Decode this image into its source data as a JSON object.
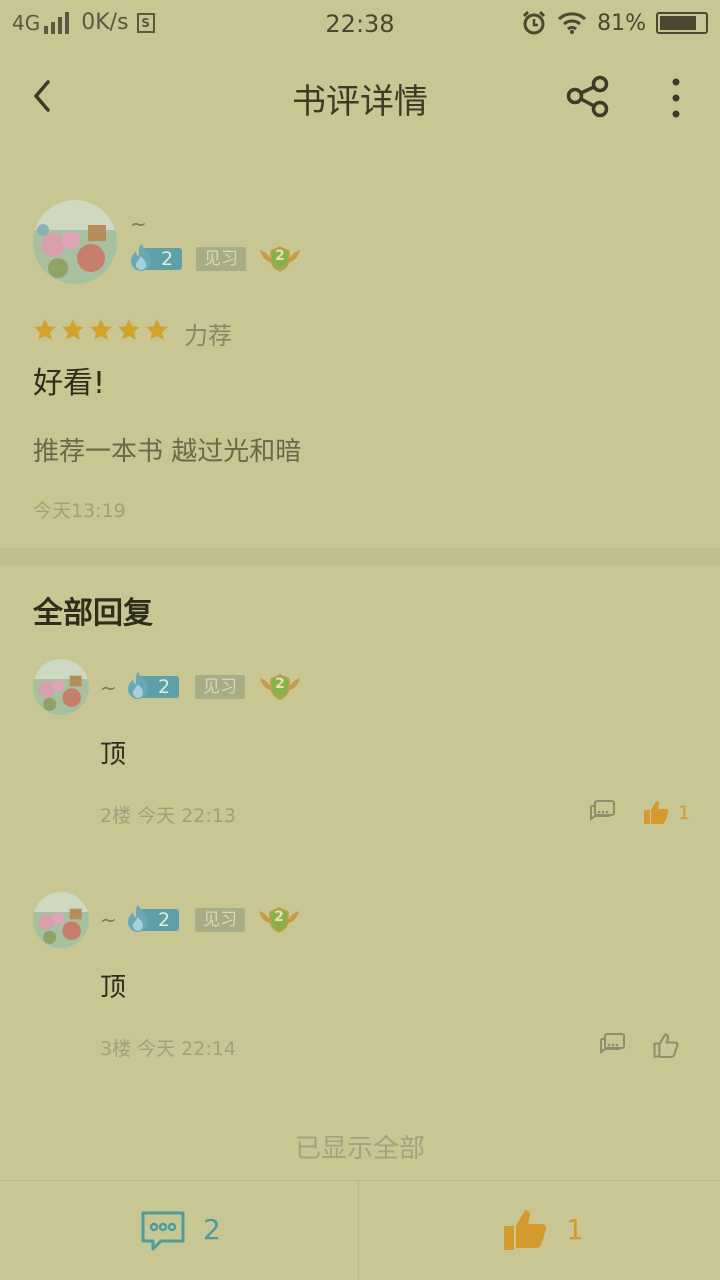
{
  "status_bar": {
    "network": "4G",
    "speed": "0K/s",
    "sim_icon": "S",
    "time": "22:38",
    "battery": "81%",
    "battery_level": 0.81
  },
  "header": {
    "title": "书评详情"
  },
  "review": {
    "nickname": "~",
    "fire_level": "2",
    "level_tag": "见习",
    "medal_level": "2",
    "stars": 5,
    "rating_label": "力荐",
    "title": "好看!",
    "body": "推荐一本书 越过光和暗",
    "time": "今天13:19"
  },
  "replies_section": {
    "title": "全部回复",
    "replies": [
      {
        "nickname": "~",
        "fire_level": "2",
        "level_tag": "见习",
        "medal_level": "2",
        "text": "顶",
        "meta": "2楼 今天 22:13",
        "likes": "1",
        "liked": true
      },
      {
        "nickname": "~",
        "fire_level": "2",
        "level_tag": "见习",
        "medal_level": "2",
        "text": "顶",
        "meta": "3楼 今天 22:14",
        "likes": "",
        "liked": false
      }
    ],
    "end_text": "已显示全部"
  },
  "bottom_bar": {
    "comment_count": "2",
    "like_count": "1"
  },
  "colors": {
    "background": "#c8c692",
    "accent_teal": "#4e9ba0",
    "accent_orange": "#d49a2e",
    "star": "#d2a22a"
  }
}
